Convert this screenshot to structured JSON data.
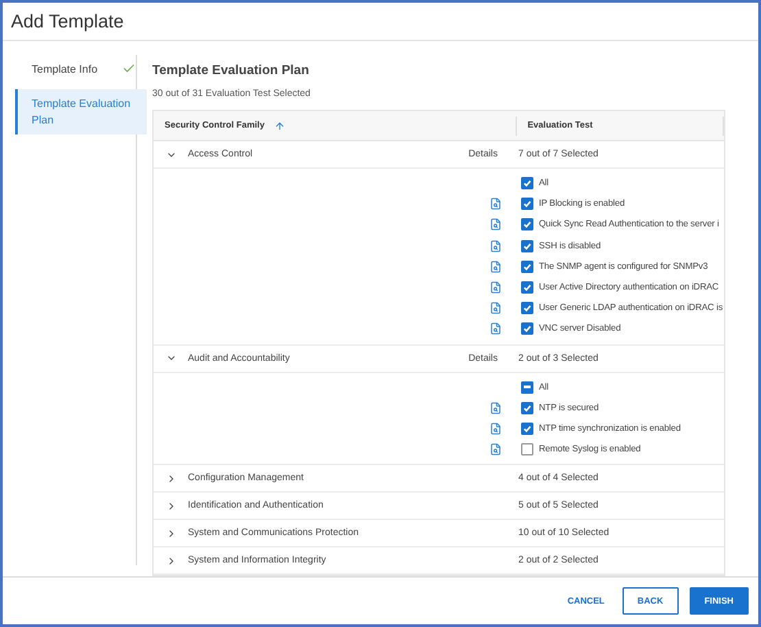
{
  "window": {
    "title": "Add Template"
  },
  "steps": [
    {
      "label": "Template Info",
      "selected": false,
      "done": true
    },
    {
      "label": "Template Evaluation Plan",
      "selected": true,
      "done": false
    }
  ],
  "panel": {
    "title": "Template Evaluation Plan",
    "summary": "30 out of 31 Evaluation Test Selected"
  },
  "table": {
    "columns": [
      {
        "label": "Security Control Family",
        "sorted": true
      },
      {
        "label": "Evaluation Test"
      }
    ],
    "rows": [
      {
        "name": "Access Control",
        "expanded": true,
        "details": "Details",
        "count": "7 out of 7 Selected",
        "tests": [
          {
            "kind": "all",
            "label": "All",
            "checked": true,
            "indeterminate": false
          },
          {
            "kind": "test",
            "label": "IP Blocking is enabled",
            "checked": true,
            "indeterminate": false
          },
          {
            "kind": "test",
            "label": "Quick Sync Read Authentication to the server i",
            "checked": true,
            "indeterminate": false
          },
          {
            "kind": "test",
            "label": "SSH is disabled",
            "checked": true,
            "indeterminate": false
          },
          {
            "kind": "test",
            "label": "The SNMP agent is configured for SNMPv3",
            "checked": true,
            "indeterminate": false
          },
          {
            "kind": "test",
            "label": "User Active Directory authentication on iDRAC",
            "checked": true,
            "indeterminate": false
          },
          {
            "kind": "test",
            "label": "User Generic LDAP authentication on iDRAC is",
            "checked": true,
            "indeterminate": false
          },
          {
            "kind": "test",
            "label": "VNC server Disabled",
            "checked": true,
            "indeterminate": false
          }
        ]
      },
      {
        "name": "Audit and Accountability",
        "expanded": true,
        "details": "Details",
        "count": "2 out of 3 Selected",
        "tests": [
          {
            "kind": "all",
            "label": "All",
            "checked": false,
            "indeterminate": true
          },
          {
            "kind": "test",
            "label": "NTP is secured",
            "checked": true,
            "indeterminate": false
          },
          {
            "kind": "test",
            "label": "NTP time synchronization is enabled",
            "checked": true,
            "indeterminate": false
          },
          {
            "kind": "test",
            "label": "Remote Syslog is enabled",
            "checked": false,
            "indeterminate": false
          }
        ]
      },
      {
        "name": "Configuration Management",
        "expanded": false,
        "count": "4 out of 4 Selected"
      },
      {
        "name": "Identification and Authentication",
        "expanded": false,
        "count": "5 out of 5 Selected"
      },
      {
        "name": "System and Communications Protection",
        "expanded": false,
        "count": "10 out of 10 Selected"
      },
      {
        "name": "System and Information Integrity",
        "expanded": false,
        "count": "2 out of 2 Selected"
      }
    ]
  },
  "buttons": [
    {
      "label": "CANCEL",
      "kind": "text"
    },
    {
      "label": "BACK",
      "kind": "outline"
    },
    {
      "label": "FINISH",
      "kind": "primary"
    }
  ]
}
